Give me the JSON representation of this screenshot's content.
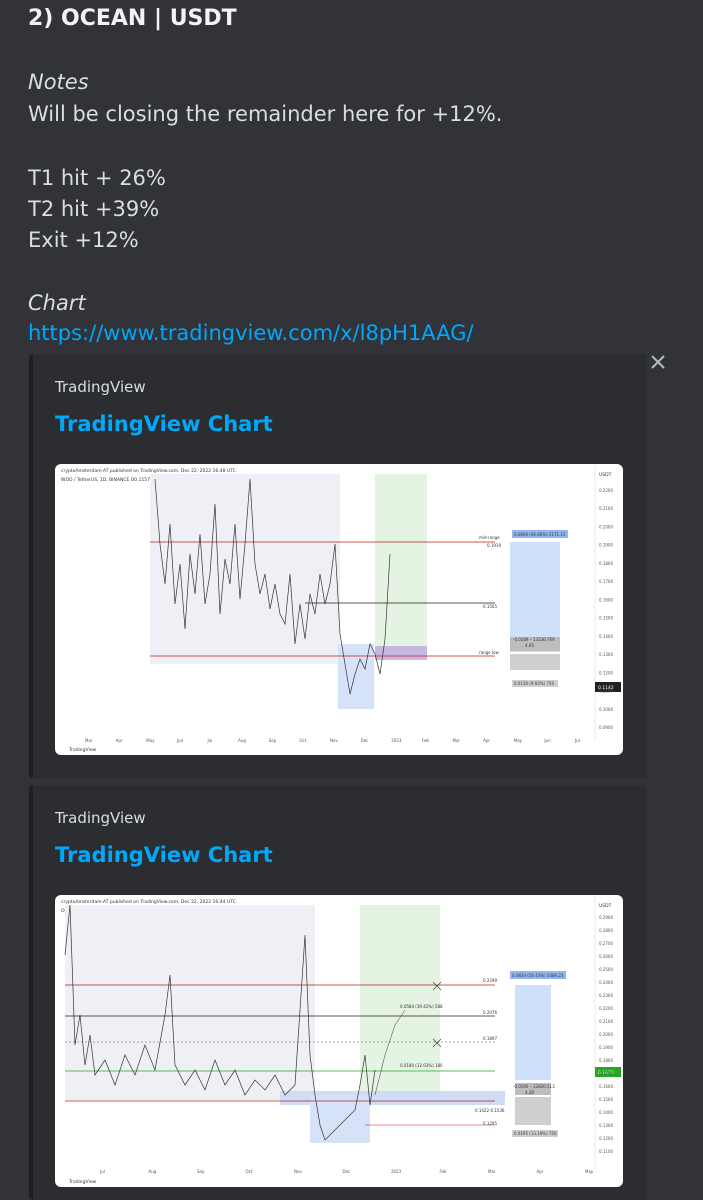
{
  "message": {
    "title": "2) OCEAN | USDT",
    "notes_label": "Notes",
    "notes_text": "Will be closing the remainder here for +12%.",
    "results": [
      "T1 hit + 26%",
      "T2 hit +39%",
      "Exit +12%"
    ],
    "chart_label": "Chart",
    "chart_link": "https://www.tradingview.com/x/l8pH1AAG/"
  },
  "embeds": [
    {
      "provider": "TradingView",
      "title": "TradingView Chart",
      "chart": {
        "header": "cryptoAmsterdam-AT published on TradingView.com, Dec 22, 2022 16:48 UTC",
        "symbol": "WOO / TetherUS, 1D, BINANCE  O0.1157  H0.1169  L0.1135  C0.1142",
        "axis_unit": "USDT",
        "y_ticks": [
          "0.2200",
          "0.2100",
          "0.2000",
          "0.1900",
          "0.1800",
          "0.1700",
          "0.1600",
          "0.1500",
          "0.1400",
          "0.1300",
          "0.1200",
          "0.1100",
          "0.1000",
          "0.0900"
        ],
        "x_ticks": [
          "Mar",
          "Apr",
          "May",
          "Jun",
          "Jul",
          "Aug",
          "Sep",
          "Oct",
          "Nov",
          "Dec",
          "2023",
          "Feb",
          "Mar",
          "Apr",
          "May",
          "Jun",
          "Jul"
        ],
        "labels": [
          "mid-range",
          "0.1919",
          "0.1565",
          "range low"
        ],
        "boxes": [
          "0.0609 (46.46%) 2171.15",
          "-0.0189 – 13230.769",
          "4.95",
          "0.0130 (9.92%) 750"
        ],
        "price_tag": "0.1142",
        "footer": "TradingView"
      }
    },
    {
      "provider": "TradingView",
      "title": "TradingView Chart",
      "chart": {
        "header": "cryptoAmsterdam-AT published on TradingView.com, Dec 22, 2022 16:44 UTC",
        "symbol": "OCEAN / TetherUS, 1D, BINANCE  O0.1661  H0.1718  L0.1624  C0.1673",
        "axis_unit": "USDT",
        "y_ticks": [
          "0.2900",
          "0.2800",
          "0.2700",
          "0.2600",
          "0.2500",
          "0.2400",
          "0.2300",
          "0.2200",
          "0.2100",
          "0.2000",
          "0.1900",
          "0.1800",
          "0.1700",
          "0.1600",
          "0.1500",
          "0.1400",
          "0.1300",
          "0.1200",
          "0.1100"
        ],
        "x_ticks": [
          "Jul",
          "Aug",
          "Sep",
          "Oct",
          "Nov",
          "Dec",
          "2023",
          "Feb",
          "Mar",
          "Apr",
          "May"
        ],
        "labels": [
          "0.2299",
          "0.2076",
          "0.1897",
          "0.1422-0.1536",
          "0.1295"
        ],
        "boxes": [
          "0.0834 (56.43%) 2089.23",
          "0.0584 (39.42%) 588",
          "0.0180 (12.03%) 180",
          "-0.0195 – 12820.513",
          "4.28",
          "0.0195 (13.19%) 750"
        ],
        "price_tag": "0.1673",
        "footer": "TradingView"
      }
    }
  ],
  "colors": {
    "background": "#313338",
    "embed_bg": "#2b2d31",
    "link": "#00a8fc"
  },
  "icons": {
    "close": "close-icon"
  }
}
